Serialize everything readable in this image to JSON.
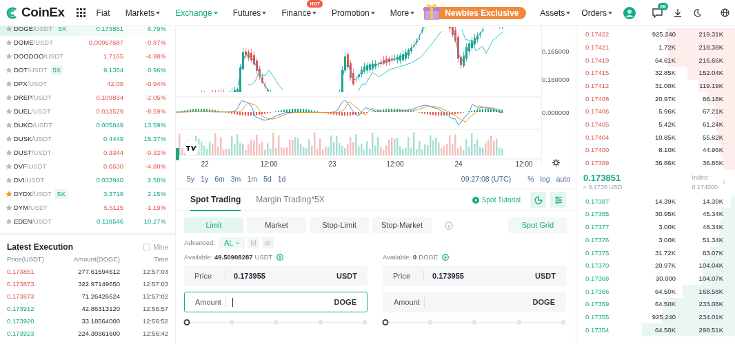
{
  "header": {
    "logo": "CoinEx",
    "nav": [
      {
        "label": "Fiat",
        "dropdown": false,
        "selected": false
      },
      {
        "label": "Markets",
        "dropdown": true,
        "selected": false
      },
      {
        "label": "Exchange",
        "dropdown": true,
        "selected": true
      },
      {
        "label": "Futures",
        "dropdown": true,
        "selected": false
      },
      {
        "label": "Finance",
        "dropdown": true,
        "selected": false,
        "badge": "HOT"
      },
      {
        "label": "Promotion",
        "dropdown": true,
        "selected": false
      },
      {
        "label": "More",
        "dropdown": true,
        "selected": false
      }
    ],
    "promo": "Newbies Exclusive",
    "account": [
      {
        "label": "Assets"
      },
      {
        "label": "Orders"
      }
    ],
    "notification_count": "26"
  },
  "markets": [
    {
      "base": "DOGE",
      "quote": "/USDT",
      "leverage": "5X",
      "price": "0.173851",
      "change": "6.79%",
      "rising": true,
      "favorite": false,
      "selected": true
    },
    {
      "base": "DOME",
      "quote": "/USDT",
      "price": "0.00057687",
      "change": "-0.87%",
      "rising": false,
      "favorite": false,
      "selected": false
    },
    {
      "base": "DOODOO",
      "quote": "/USDT",
      "price": "1.7165",
      "change": "-4.98%",
      "rising": false,
      "favorite": false,
      "selected": false
    },
    {
      "base": "DOT",
      "quote": "/USDT",
      "leverage": "5X",
      "price": "9.1354",
      "change": "0.96%",
      "rising": true,
      "favorite": false,
      "selected": false
    },
    {
      "base": "DPX",
      "quote": "/USDT",
      "price": "42.09",
      "change": "-0.94%",
      "rising": false,
      "favorite": false,
      "selected": false
    },
    {
      "base": "DREP",
      "quote": "/USDT",
      "price": "0.109834",
      "change": "-2.05%",
      "rising": false,
      "favorite": false,
      "selected": false
    },
    {
      "base": "DUEL",
      "quote": "/USDT",
      "price": "0.013529",
      "change": "-8.59%",
      "rising": false,
      "favorite": false,
      "selected": false
    },
    {
      "base": "DUKO",
      "quote": "/USDT",
      "price": "0.005849",
      "change": "13.59%",
      "rising": true,
      "favorite": false,
      "selected": false
    },
    {
      "base": "DUSK",
      "quote": "/USDT",
      "price": "0.4449",
      "change": "15.37%",
      "rising": true,
      "favorite": false,
      "selected": false
    },
    {
      "base": "DUST",
      "quote": "/USDT",
      "price": "0.3344",
      "change": "-0.32%",
      "rising": false,
      "favorite": false,
      "selected": false
    },
    {
      "base": "DVF",
      "quote": "/USDT",
      "price": "0.6630",
      "change": "-4.80%",
      "rising": false,
      "favorite": false,
      "selected": false
    },
    {
      "base": "DVI",
      "quote": "/USDT",
      "price": "0.033940",
      "change": "2.50%",
      "rising": true,
      "favorite": false,
      "selected": false
    },
    {
      "base": "DYDX",
      "quote": "/USDT",
      "leverage": "5X",
      "price": "3.3719",
      "change": "2.15%",
      "rising": true,
      "favorite": true,
      "selected": false
    },
    {
      "base": "DYM",
      "quote": "/USDT",
      "price": "5.5115",
      "change": "-1.19%",
      "rising": false,
      "favorite": false,
      "selected": false
    },
    {
      "base": "EDEN",
      "quote": "/USDT",
      "price": "0.118546",
      "change": "10.27%",
      "rising": true,
      "favorite": false,
      "selected": false
    }
  ],
  "latest_execution": {
    "title": "Latest Execution",
    "mine_label": "Mine",
    "mine_checked": false,
    "columns": [
      "Price(USDT)",
      "Amount(DOGE)",
      "Time"
    ],
    "rows": [
      {
        "price": "0.173851",
        "amount": "277.61594612",
        "time": "12:57:03",
        "buy": false
      },
      {
        "price": "0.173873",
        "amount": "322.97149650",
        "time": "12:57:03",
        "buy": false
      },
      {
        "price": "0.173873",
        "amount": "71.26426624",
        "time": "12:57:02",
        "buy": false
      },
      {
        "price": "0.173912",
        "amount": "42.86313120",
        "time": "12:56:57",
        "buy": true
      },
      {
        "price": "0.173920",
        "amount": "33.18564000",
        "time": "12:56:52",
        "buy": true
      },
      {
        "price": "0.173923",
        "amount": "224.30361600",
        "time": "12:56:42",
        "buy": true
      }
    ]
  },
  "chart": {
    "price_labels": [
      "0.165000",
      "0.160000"
    ],
    "indicator_label": "0.000000",
    "time_labels": [
      "22",
      "12:00",
      "23",
      "12:00",
      "24",
      "12:00"
    ],
    "ranges": [
      "5y",
      "1y",
      "6m",
      "3m",
      "1m",
      "5d",
      "1d"
    ],
    "clock": "09:27:08 (UTC)",
    "options": [
      "%",
      "log",
      "auto"
    ]
  },
  "trade": {
    "tabs": [
      {
        "label": "Spot Trading",
        "selected": true
      },
      {
        "label": "Margin Trading*5X",
        "selected": false
      }
    ],
    "tutorial": "Spot Tutorial",
    "order_types": [
      {
        "label": "Limit",
        "selected": true
      },
      {
        "label": "Market",
        "selected": false
      },
      {
        "label": "Stop-Limit",
        "selected": false
      },
      {
        "label": "Stop-Market",
        "selected": false
      }
    ],
    "grid_button": "Spot Grid",
    "advanced_label": "Advanced:",
    "advanced_mode": "AL",
    "advanced_extra": "M",
    "sides": [
      {
        "available_label": "Available:",
        "available_value": "49.50908287",
        "available_unit": "USDT",
        "price_label": "Price",
        "price_value": "0.173955",
        "price_unit": "USDT",
        "amount_label": "Amount",
        "amount_unit": "DOGE",
        "focused": true,
        "level": 0
      },
      {
        "available_label": "Available:",
        "available_value": "0",
        "available_unit": "DOGE",
        "price_label": "Price",
        "price_value": "0.173955",
        "price_unit": "USDT",
        "amount_label": "Amount",
        "amount_unit": "DOGE",
        "focused": false,
        "level": 0
      }
    ]
  },
  "order_book": {
    "asks": [
      {
        "price": "0.17422",
        "amount": "925.240",
        "total": "219.31K"
      },
      {
        "price": "0.17421",
        "amount": "1.72K",
        "total": "218.38K"
      },
      {
        "price": "0.17419",
        "amount": "64.61K",
        "total": "216.66K"
      },
      {
        "price": "0.17415",
        "amount": "32.85K",
        "total": "152.04K"
      },
      {
        "price": "0.17412",
        "amount": "31.00K",
        "total": "119.19K"
      },
      {
        "price": "0.17408",
        "amount": "20.97K",
        "total": "88.18K"
      },
      {
        "price": "0.17406",
        "amount": "5.96K",
        "total": "67.21K"
      },
      {
        "price": "0.17405",
        "amount": "5.42K",
        "total": "61.24K"
      },
      {
        "price": "0.17404",
        "amount": "10.85K",
        "total": "55.82K"
      },
      {
        "price": "0.17400",
        "amount": "8.10K",
        "total": "44.96K"
      },
      {
        "price": "0.17399",
        "amount": "36.86K",
        "total": "36.86K"
      }
    ],
    "last_price": "0.173851",
    "last_usd": "≈ 0.1738 USD",
    "index_label": "Index:",
    "index_value": "0.174000",
    "bids": [
      {
        "price": "0.17387",
        "amount": "14.39K",
        "total": "14.39K"
      },
      {
        "price": "0.17385",
        "amount": "30.95K",
        "total": "45.34K"
      },
      {
        "price": "0.17377",
        "amount": "3.00K",
        "total": "48.34K"
      },
      {
        "price": "0.17376",
        "amount": "3.00K",
        "total": "51.34K"
      },
      {
        "price": "0.17375",
        "amount": "31.72K",
        "total": "83.07K"
      },
      {
        "price": "0.17370",
        "amount": "20.97K",
        "total": "104.04K"
      },
      {
        "price": "0.17368",
        "amount": "30.000",
        "total": "104.07K"
      },
      {
        "price": "0.17366",
        "amount": "64.50K",
        "total": "168.58K"
      },
      {
        "price": "0.17359",
        "amount": "64.50K",
        "total": "233.08K"
      },
      {
        "price": "0.17355",
        "amount": "925.240",
        "total": "234.01K"
      },
      {
        "price": "0.17354",
        "amount": "64.50K",
        "total": "298.51K"
      }
    ]
  }
}
